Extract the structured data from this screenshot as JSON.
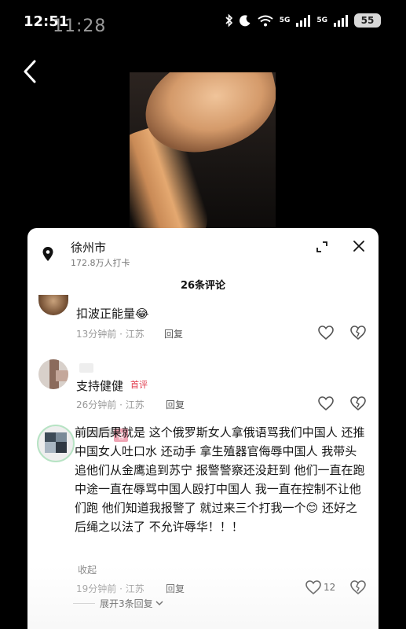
{
  "status_bar": {
    "time_primary": "12:51",
    "time_ghost": "11:28",
    "network_a": "5G",
    "network_b": "5G",
    "battery": "55"
  },
  "icons": {
    "back": "chevron-left-icon",
    "location": "map-pin-icon",
    "expand": "expand-icon",
    "close": "close-icon",
    "like": "heart-icon",
    "dislike": "broken-heart-icon"
  },
  "location": {
    "city": "徐州市",
    "checkins": "172.8万人打卡"
  },
  "comments_header": {
    "count_label": "26条评论"
  },
  "comments": [
    {
      "text": "扣波正能量😂",
      "meta": "13分钟前 · 江苏",
      "reply_label": "回复"
    },
    {
      "text": "支持健健",
      "tag": "首评",
      "meta": "26分钟前 · 江苏",
      "reply_label": "回复"
    },
    {
      "badge": "者",
      "text": "前因后果就是 这个俄罗斯女人拿俄语骂我们中国人 还推中国女人吐口水 还动手 拿生殖器官侮辱中国人 我带头追他们从金鹰追到苏宁 报警警察还没赶到 他们一直在跑 中途一直在辱骂中国人殴打中国人 我一直在控制不让他们跑 他们知道我报警了 就过来三个打我一个😊 还好之后绳之以法了 不允许辱华！！！",
      "collapse_label": "收起",
      "meta": "19分钟前 · 江苏",
      "reply_label": "回复",
      "likes": "12",
      "expand_replies_label": "展开3条回复"
    }
  ],
  "colors": {
    "background": "#000000",
    "panel": "#ffffff",
    "first_tag": "#e0394b",
    "badge": "#f0a5b5",
    "meta_text": "#999999"
  }
}
